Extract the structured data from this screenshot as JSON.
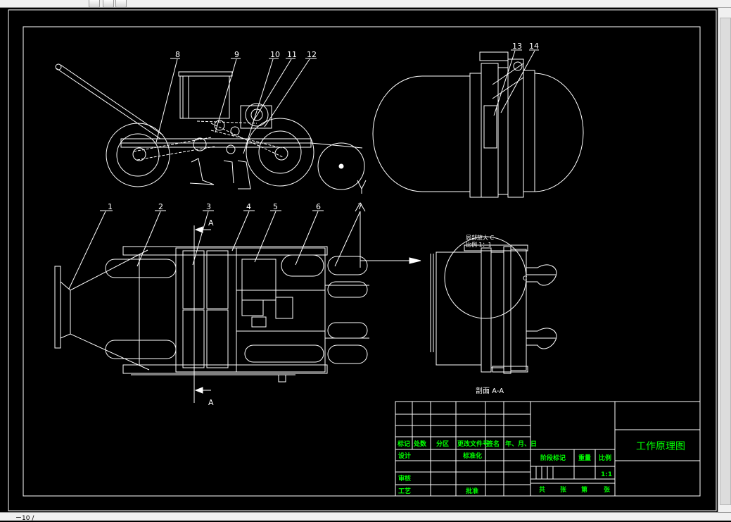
{
  "drawing": {
    "part_numbers": [
      "1",
      "2",
      "3",
      "4",
      "5",
      "6",
      "7",
      "8",
      "9",
      "10",
      "11",
      "12",
      "13",
      "14"
    ],
    "section_marker": "A",
    "section_label": "剖面 A-A",
    "detail_label_line1": "局部放大 C",
    "detail_label_line2": "比例 1：1",
    "detail_marker": "C"
  },
  "title_block": {
    "drawing_title": "工作原理图",
    "headers": [
      "标记",
      "处数",
      "分区",
      "更改文件号",
      "签名",
      "年、月、日"
    ],
    "design": "设计",
    "standardization": "标准化",
    "review": "审核",
    "process": "工艺",
    "approve": "批准",
    "stage_mark": "阶段标记",
    "weight": "重量",
    "scale_label": "比例",
    "scale_value": "1:1",
    "sheets": [
      "共",
      "张",
      "第",
      "张"
    ]
  },
  "statusbar": {
    "coordinate": "ㄧ10 /"
  },
  "colors": {
    "line": "#ffffff",
    "text_green": "#00ff00",
    "background": "#000000"
  }
}
